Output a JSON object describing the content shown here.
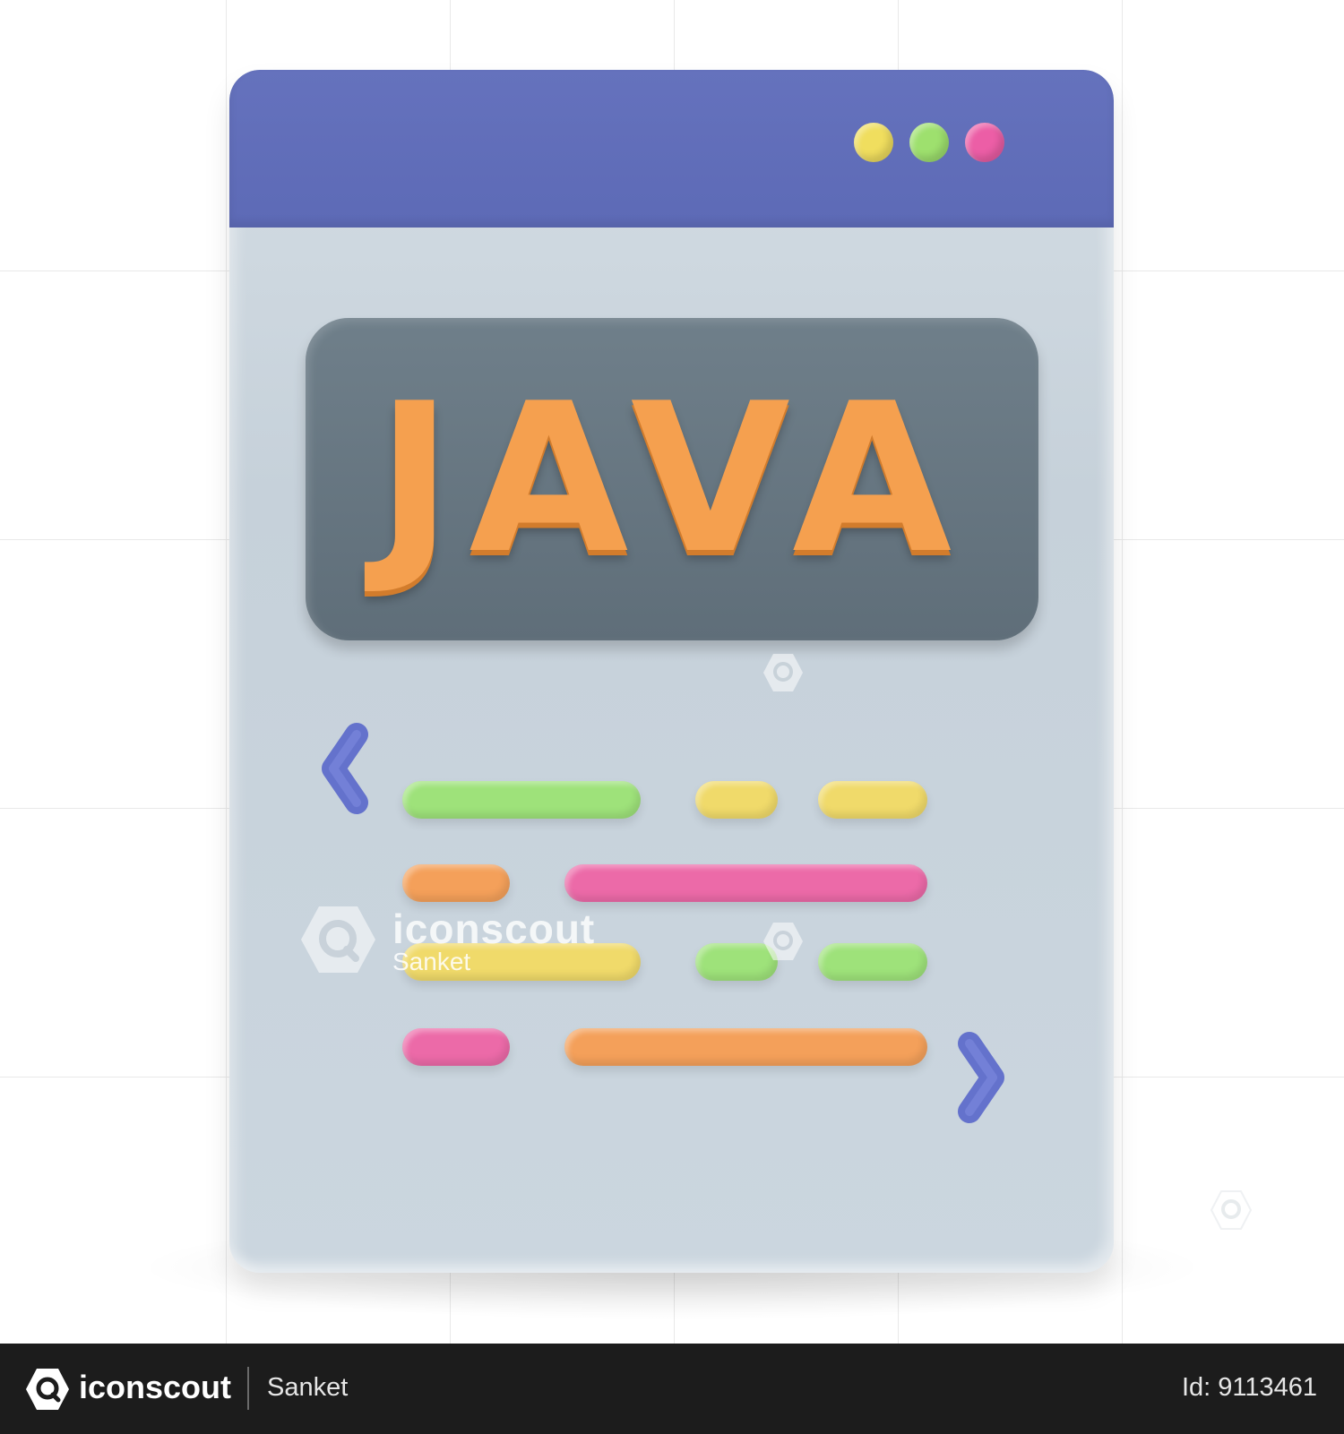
{
  "icon": {
    "banner_text": "JAVA",
    "window_controls": [
      "yellow-dot",
      "green-dot",
      "pink-dot"
    ],
    "colors": {
      "titlebar": "#5f6cb8",
      "banner": "#66757f",
      "text": "#f5a04f",
      "chevron": "#6472cc",
      "green": "#9ee27a",
      "yellow": "#f0da6a",
      "orange": "#f4a05a",
      "pink": "#ec6aa8"
    },
    "code_lines": [
      [
        "green",
        "yellow",
        "yellow"
      ],
      [
        "orange",
        "pink"
      ],
      [
        "yellow",
        "green",
        "green"
      ],
      [
        "pink",
        "orange"
      ]
    ]
  },
  "watermark": {
    "brand": "iconscout",
    "author": "Sanket"
  },
  "footer": {
    "brand": "iconscout",
    "author": "Sanket",
    "id_label": "Id: 9113461"
  }
}
